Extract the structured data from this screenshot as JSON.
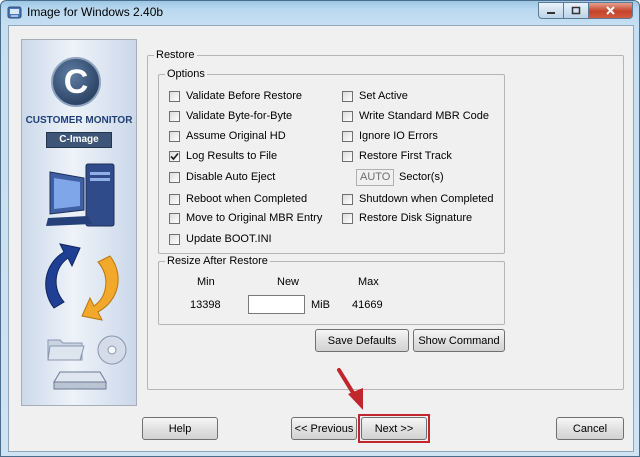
{
  "window": {
    "title": "Image for Windows 2.40b"
  },
  "sidebar": {
    "logo_letter": "C",
    "brand": "CUSTOMER MONITOR",
    "product": "C-Image"
  },
  "restore": {
    "group_label": "Restore",
    "options": {
      "group_label": "Options",
      "left": [
        {
          "label": "Validate Before Restore",
          "checked": false
        },
        {
          "label": "Validate Byte-for-Byte",
          "checked": false
        },
        {
          "label": "Assume Original HD",
          "checked": false
        },
        {
          "label": "Log Results to File",
          "checked": true
        },
        {
          "label": "Disable Auto Eject",
          "checked": false
        },
        {
          "label": "Reboot when Completed",
          "checked": false
        },
        {
          "label": "Move to Original MBR Entry",
          "checked": false
        },
        {
          "label": "Update BOOT.INI",
          "checked": false
        }
      ],
      "right": [
        {
          "label": "Set Active",
          "checked": false
        },
        {
          "label": "Write Standard MBR Code",
          "checked": false
        },
        {
          "label": "Ignore IO Errors",
          "checked": false
        },
        {
          "label": "Restore First Track",
          "checked": false
        },
        {
          "label": "Shutdown when Completed",
          "checked": false
        },
        {
          "label": "Restore Disk Signature",
          "checked": false
        }
      ],
      "sector_value": "AUTO",
      "sector_label": "Sector(s)"
    },
    "resize": {
      "group_label": "Resize After Restore",
      "min_label": "Min",
      "new_label": "New",
      "max_label": "Max",
      "min_value": "13398",
      "new_value": "",
      "unit": "MiB",
      "max_value": "41669"
    },
    "save_defaults": "Save Defaults",
    "show_command": "Show Command"
  },
  "footer": {
    "help": "Help",
    "previous": "<< Previous",
    "next": "Next >>",
    "cancel": "Cancel"
  },
  "colors": {
    "highlight": "#c0262b",
    "arrow": "#c0262b"
  }
}
